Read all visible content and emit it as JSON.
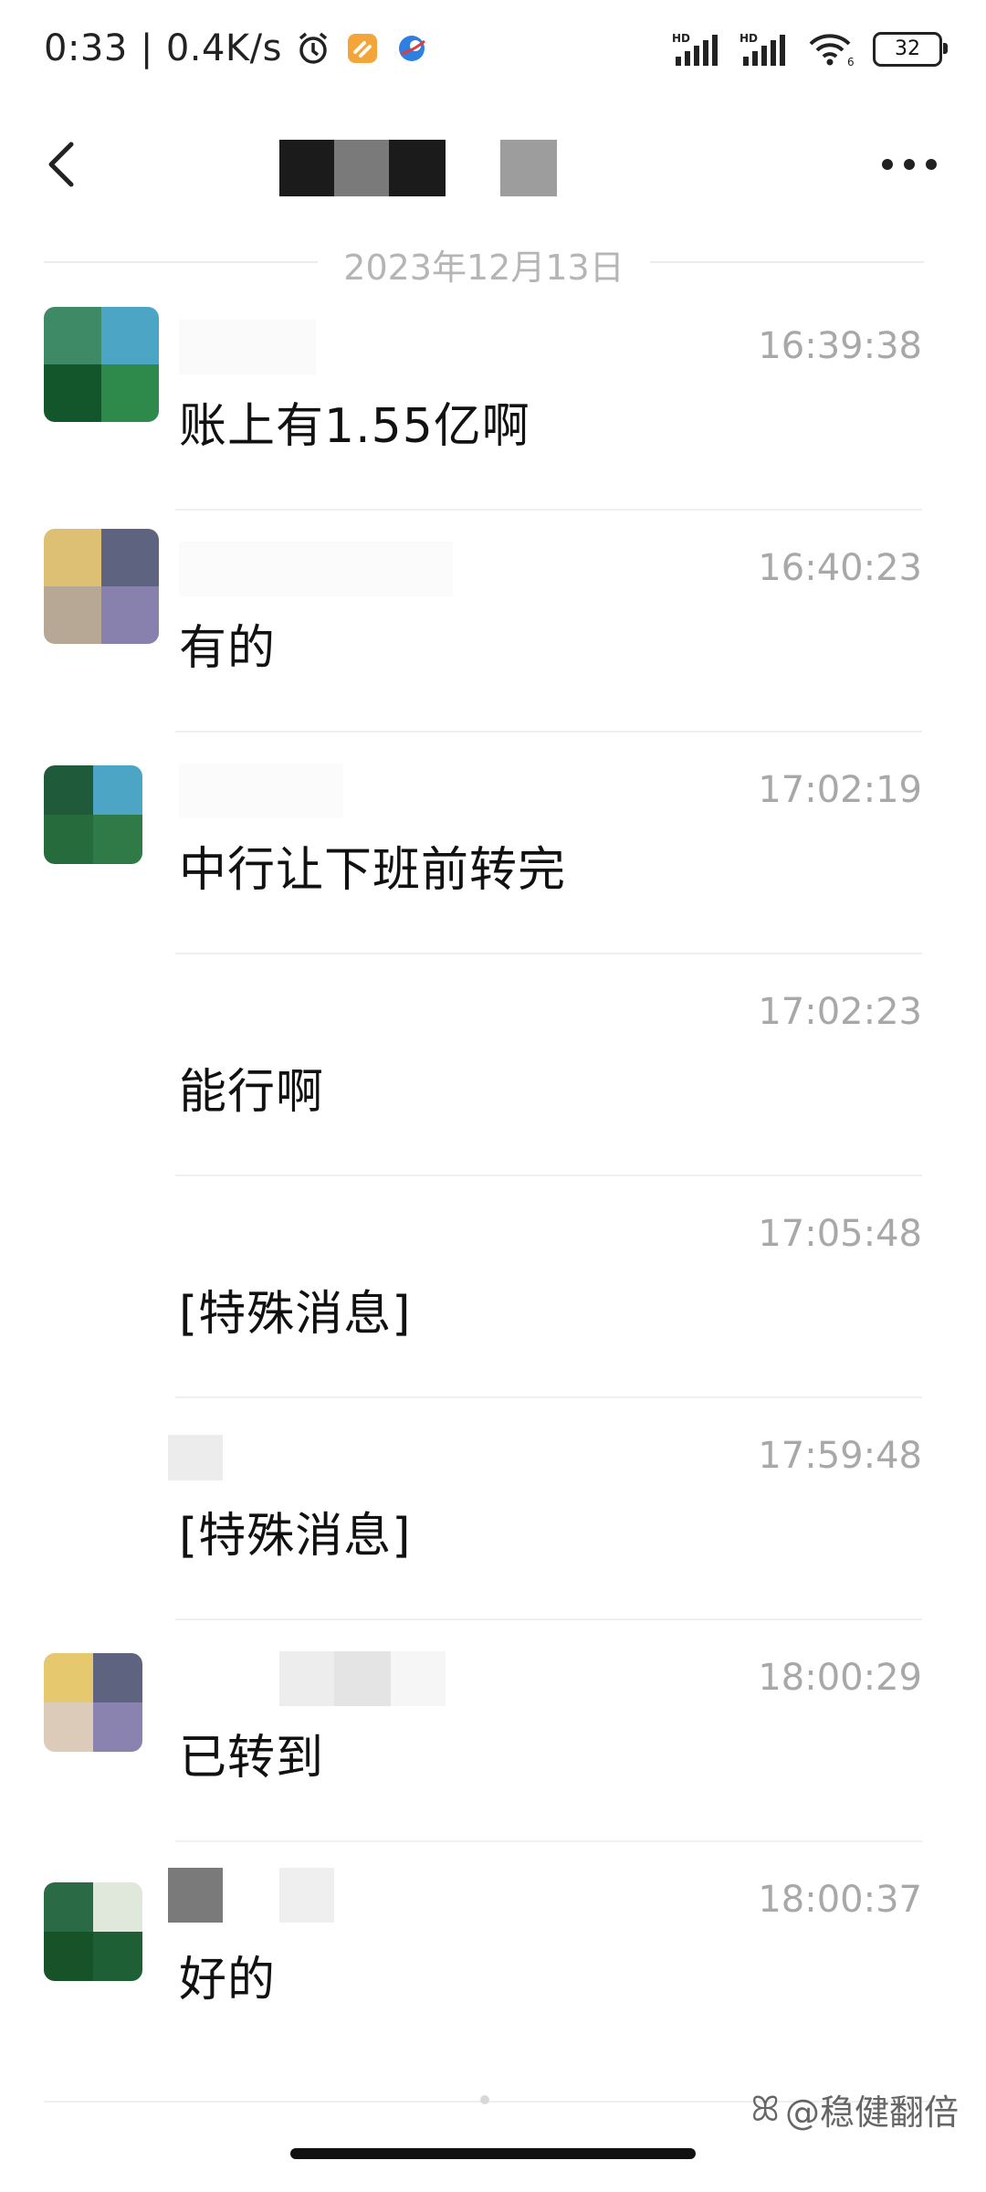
{
  "status_bar": {
    "time": "0:33",
    "net_speed": "0.4K/s",
    "signal1_label": "HD",
    "signal2_label": "HD",
    "wifi_badge": "6",
    "battery": "32"
  },
  "nav": {
    "back_icon": "chevron-left-icon",
    "more_icon": "more-horizontal-icon"
  },
  "date_separator": "2023年12月13日",
  "messages": [
    {
      "time": "16:39:38",
      "text": "账上有1.55亿啊"
    },
    {
      "time": "16:40:23",
      "text": "有的"
    },
    {
      "time": "17:02:19",
      "text": "中行让下班前转完"
    },
    {
      "time": "17:02:23",
      "text": "能行啊"
    },
    {
      "time": "17:05:48",
      "text": "[特殊消息]"
    },
    {
      "time": "17:59:48",
      "text": "[特殊消息]"
    },
    {
      "time": "18:00:29",
      "text": "已转到"
    },
    {
      "time": "18:00:37",
      "text": "好的"
    }
  ],
  "watermark": "@稳健翻倍",
  "colors": {
    "time_gray": "#a8a8a8",
    "separator": "#efefef"
  }
}
